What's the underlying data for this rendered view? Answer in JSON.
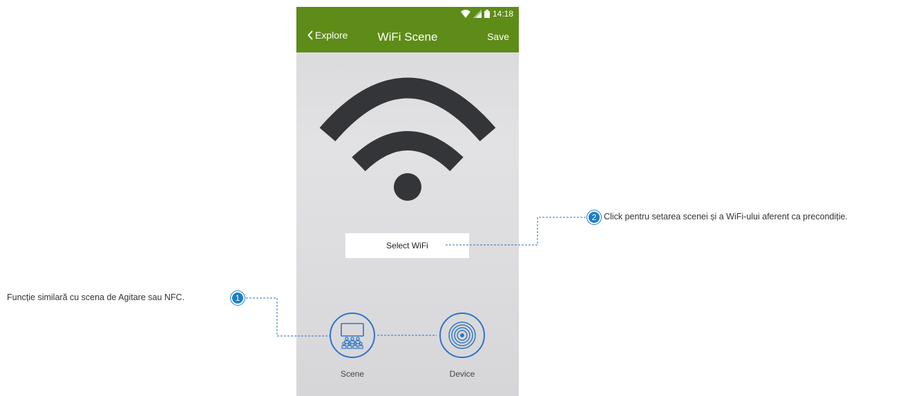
{
  "status_bar": {
    "time": "14:18"
  },
  "app_bar": {
    "back_label": "Explore",
    "title": "WiFi Scene",
    "save_label": "Save"
  },
  "main": {
    "select_wifi_label": "Select WiFi"
  },
  "bottom": {
    "scene_label": "Scene",
    "device_label": "Device"
  },
  "annotations": [
    {
      "number": "1",
      "text": "Funcție similară cu scena de Agitare sau NFC."
    },
    {
      "number": "2",
      "text": "Click pentru setarea scenei și a WiFi-ului aferent ca precondiție."
    }
  ],
  "colors": {
    "app_bar": "#5e8c18",
    "accent": "#2f74c5",
    "badge": "#1b7ec9",
    "wifi_icon": "#333538"
  },
  "icons": [
    "wifi-status-icon",
    "signal-icon",
    "battery-icon",
    "chevron-left-icon",
    "wifi-icon",
    "scene-icon",
    "device-icon"
  ]
}
